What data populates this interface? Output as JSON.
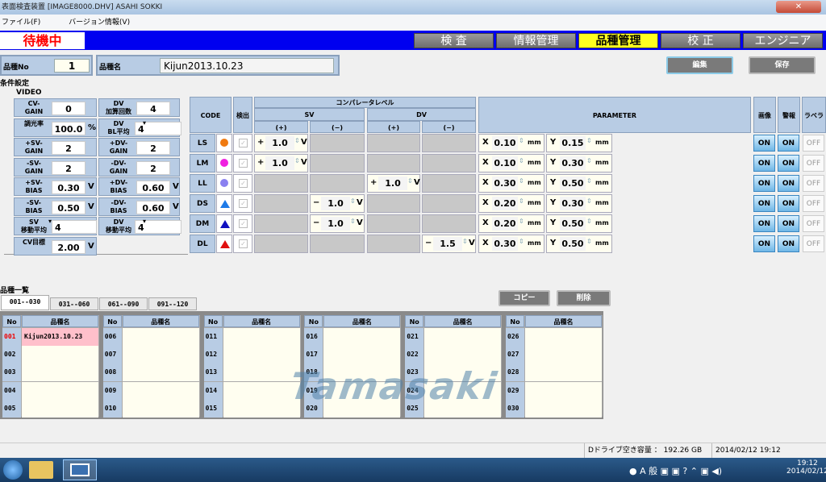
{
  "window": {
    "title": "表面検査装置 [IMAGE8000.DHV] ASAHI SOKKI",
    "close_icon": "close-icon"
  },
  "menu": [
    "ファイル(F)",
    "バージョン情報(V)"
  ],
  "status": "待機中",
  "mode_tabs": [
    {
      "label": "検 査",
      "active": false
    },
    {
      "label": "情報管理",
      "active": false
    },
    {
      "label": "品種管理",
      "active": true
    },
    {
      "label": "校 正",
      "active": false
    },
    {
      "label": "エンジニア",
      "active": false
    }
  ],
  "product": {
    "no_label": "品種No",
    "no_value": "1",
    "name_label": "品種名",
    "name_value": "Kijun2013.10.23"
  },
  "buttons": {
    "edit": "編集",
    "save": "保存",
    "copy": "コピー",
    "delete": "削除"
  },
  "settings_label": "条件設定",
  "video": {
    "label": "VIDEO",
    "cells": [
      {
        "label": "CV-\nGAIN",
        "value": "0",
        "unit": ""
      },
      {
        "label": "DV\n加算回数",
        "value": "4",
        "unit": ""
      },
      {
        "label": "調光率",
        "value": "100.0",
        "unit": "%"
      },
      {
        "label": "DV\nBL平均",
        "value": "4",
        "unit": "",
        "dropdown": true
      },
      {
        "label": "+SV-\nGAIN",
        "value": "2",
        "unit": ""
      },
      {
        "label": "+DV-\nGAIN",
        "value": "2",
        "unit": ""
      },
      {
        "label": "-SV-\nGAIN",
        "value": "2",
        "unit": ""
      },
      {
        "label": "-DV-\nGAIN",
        "value": "2",
        "unit": ""
      },
      {
        "label": "+SV-\nBIAS",
        "value": "0.30",
        "unit": "V"
      },
      {
        "label": "+DV-\nBIAS",
        "value": "0.60",
        "unit": "V"
      },
      {
        "label": "-SV-\nBIAS",
        "value": "0.50",
        "unit": "V"
      },
      {
        "label": "-DV-\nBIAS",
        "value": "0.60",
        "unit": "V"
      },
      {
        "label": "SV\n移動平均",
        "value": "4",
        "unit": "",
        "dropdown": true
      },
      {
        "label": "DV\n移動平均",
        "value": "4",
        "unit": "",
        "dropdown": true
      },
      {
        "label": "CV目標",
        "value": "2.00",
        "unit": "V"
      }
    ]
  },
  "table": {
    "headers": {
      "code": "CODE",
      "detect": "検出",
      "comparator": "コンパレータレベル",
      "sv": "SV",
      "dv": "DV",
      "plus": "(+)",
      "minus": "(−)",
      "parameter": "PARAMETER",
      "image": "画像",
      "alarm": "警報",
      "label": "ラベラ"
    },
    "rows": [
      {
        "code": "LS",
        "mark": "circle",
        "color": "#f07a10",
        "sv_plus": "1.0",
        "sv_minus": null,
        "dv_plus": null,
        "dv_minus": null,
        "x": "0.10",
        "y": "0.15",
        "image": "ON",
        "alarm": "ON",
        "labeler": "OFF"
      },
      {
        "code": "LM",
        "mark": "circle",
        "color": "#f020e0",
        "sv_plus": "1.0",
        "sv_minus": null,
        "dv_plus": null,
        "dv_minus": null,
        "x": "0.10",
        "y": "0.30",
        "image": "ON",
        "alarm": "ON",
        "labeler": "OFF"
      },
      {
        "code": "LL",
        "mark": "circle",
        "color": "#8a80f0",
        "sv_plus": null,
        "sv_minus": null,
        "dv_plus": "1.0",
        "dv_minus": null,
        "x": "0.30",
        "y": "0.50",
        "image": "ON",
        "alarm": "ON",
        "labeler": "OFF"
      },
      {
        "code": "DS",
        "mark": "triangle",
        "color": "#1e7ae8",
        "sv_plus": null,
        "sv_minus": "1.0",
        "dv_plus": null,
        "dv_minus": null,
        "x": "0.20",
        "y": "0.30",
        "image": "ON",
        "alarm": "ON",
        "labeler": "OFF"
      },
      {
        "code": "DM",
        "mark": "triangle",
        "color": "#1010c0",
        "sv_plus": null,
        "sv_minus": "1.0",
        "dv_plus": null,
        "dv_minus": null,
        "x": "0.20",
        "y": "0.50",
        "image": "ON",
        "alarm": "ON",
        "labeler": "OFF"
      },
      {
        "code": "DL",
        "mark": "triangle",
        "color": "#e01010",
        "sv_plus": null,
        "sv_minus": null,
        "dv_plus": null,
        "dv_minus": "1.5",
        "x": "0.30",
        "y": "0.50",
        "image": "ON",
        "alarm": "ON",
        "labeler": "OFF"
      }
    ],
    "units": {
      "v": "V",
      "mm": "mm",
      "x": "X",
      "y": "Y",
      "plus_sign": "+",
      "minus_sign": "−"
    }
  },
  "list": {
    "label": "品種一覧",
    "tabs": [
      "001--030",
      "031--060",
      "061--090",
      "091--120"
    ],
    "active_tab": 0,
    "col_no": "No",
    "col_name": "品種名",
    "items": [
      {
        "no": "001",
        "name": "Kijun2013.10.23",
        "selected": true
      },
      {
        "no": "002",
        "name": ""
      },
      {
        "no": "003",
        "name": ""
      },
      {
        "no": "004",
        "name": ""
      },
      {
        "no": "005",
        "name": ""
      },
      {
        "no": "006",
        "name": ""
      },
      {
        "no": "007",
        "name": ""
      },
      {
        "no": "008",
        "name": ""
      },
      {
        "no": "009",
        "name": ""
      },
      {
        "no": "010",
        "name": ""
      },
      {
        "no": "011",
        "name": ""
      },
      {
        "no": "012",
        "name": ""
      },
      {
        "no": "013",
        "name": ""
      },
      {
        "no": "014",
        "name": ""
      },
      {
        "no": "015",
        "name": ""
      },
      {
        "no": "016",
        "name": ""
      },
      {
        "no": "017",
        "name": ""
      },
      {
        "no": "018",
        "name": ""
      },
      {
        "no": "019",
        "name": ""
      },
      {
        "no": "020",
        "name": ""
      },
      {
        "no": "021",
        "name": ""
      },
      {
        "no": "022",
        "name": ""
      },
      {
        "no": "023",
        "name": ""
      },
      {
        "no": "024",
        "name": ""
      },
      {
        "no": "025",
        "name": ""
      },
      {
        "no": "026",
        "name": ""
      },
      {
        "no": "027",
        "name": ""
      },
      {
        "no": "028",
        "name": ""
      },
      {
        "no": "029",
        "name": ""
      },
      {
        "no": "030",
        "name": ""
      }
    ]
  },
  "watermark": "Tamasaki",
  "statusbar": {
    "disk": "Dドライブ空き容量 ： 192.26 GB",
    "datetime": "2014/02/12 19:12"
  },
  "taskbar": {
    "time": "19:12",
    "date": "2014/02/12"
  }
}
